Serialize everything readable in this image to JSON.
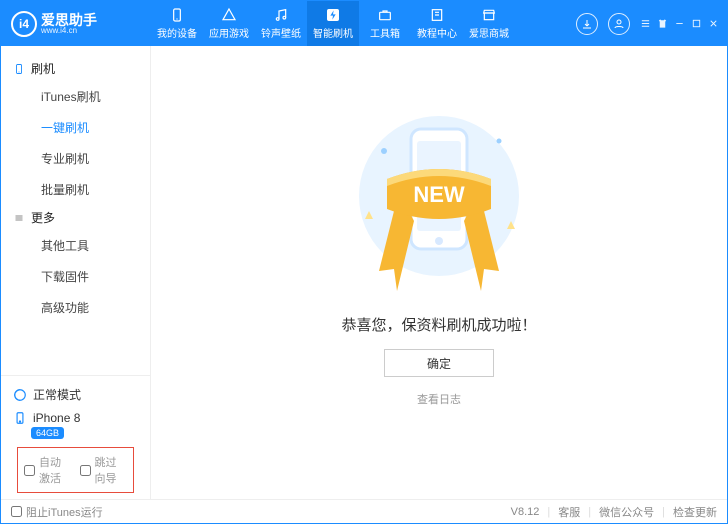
{
  "brand": {
    "title": "爱思助手",
    "sub": "www.i4.cn",
    "logo": "i4"
  },
  "tabs": [
    {
      "label": "我的设备",
      "icon": "device"
    },
    {
      "label": "应用游戏",
      "icon": "apps"
    },
    {
      "label": "铃声壁纸",
      "icon": "music"
    },
    {
      "label": "智能刷机",
      "icon": "flash",
      "active": true
    },
    {
      "label": "工具箱",
      "icon": "toolbox"
    },
    {
      "label": "教程中心",
      "icon": "book"
    },
    {
      "label": "爱思商城",
      "icon": "store"
    }
  ],
  "sidebar": {
    "groups": [
      {
        "title": "刷机",
        "icon": "phone",
        "items": [
          "iTunes刷机",
          "一键刷机",
          "专业刷机",
          "批量刷机"
        ],
        "activeIndex": 1
      },
      {
        "title": "更多",
        "icon": "more",
        "items": [
          "其他工具",
          "下载固件",
          "高级功能"
        ]
      }
    ],
    "mode": "正常模式",
    "device": {
      "name": "iPhone 8",
      "storage": "64GB"
    },
    "options": {
      "autoActivate": "自动激活",
      "skipGuide": "跳过向导"
    }
  },
  "main": {
    "ribbon": "NEW",
    "message": "恭喜您，保资料刷机成功啦！",
    "ok": "确定",
    "logLink": "查看日志"
  },
  "footer": {
    "blockItunes": "阻止iTunes运行",
    "version": "V8.12",
    "support": "客服",
    "wechat": "微信公众号",
    "update": "检查更新"
  }
}
